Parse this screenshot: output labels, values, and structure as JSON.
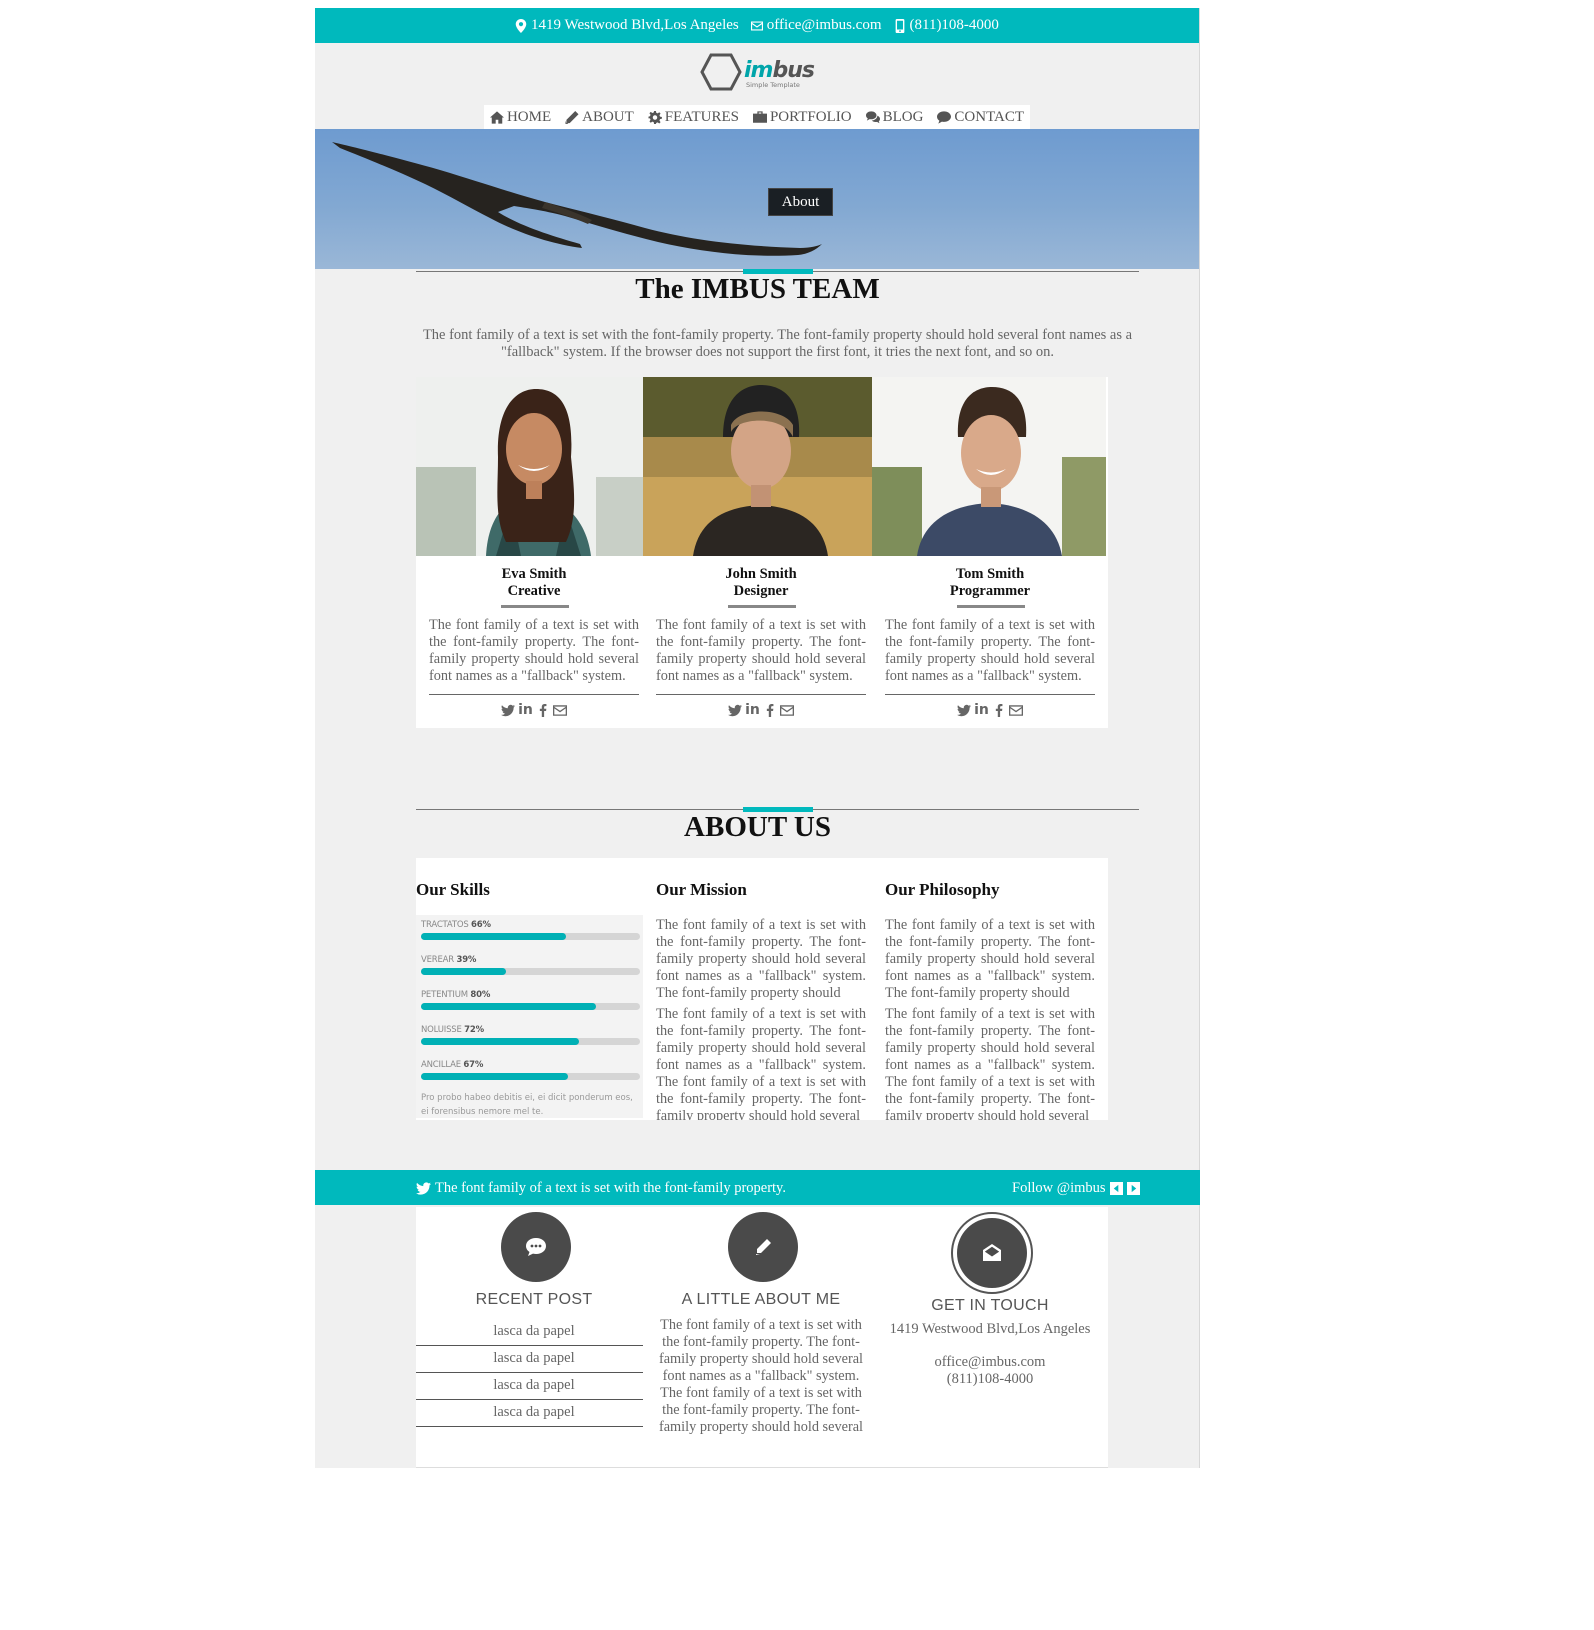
{
  "topbar": {
    "address": "1419 Westwood Blvd,Los Angeles",
    "email": "office@imbus.com",
    "phone": "(811)108-4000"
  },
  "logo": {
    "name_part1": "im",
    "name_part2": "bus",
    "tagline": "Simple Template"
  },
  "nav": [
    {
      "label": "HOME",
      "icon": "home-icon"
    },
    {
      "label": "ABOUT",
      "icon": "pencil-icon"
    },
    {
      "label": "FEATURES",
      "icon": "gear-icon"
    },
    {
      "label": "PORTFOLIO",
      "icon": "briefcase-icon"
    },
    {
      "label": "BLOG",
      "icon": "comments-icon"
    },
    {
      "label": "CONTACT",
      "icon": "comment-icon"
    }
  ],
  "hero": {
    "breadcrumb": "About"
  },
  "team": {
    "title": "The IMBUS TEAM",
    "lead": "The font family of a text is set with the font-family property. The font-family property should hold several font names as a \"fallback\" system. If the browser does not support the first font, it tries the next font, and so on.",
    "members": [
      {
        "name": "Eva Smith",
        "role": "Creative",
        "text": "The font family of a text is set with the font-family property. The font-family property should hold several font names as a \"fallback\" system.",
        "in_label": "in"
      },
      {
        "name": "John Smith",
        "role": "Designer",
        "text": "The font family of a text is set with the font-family property. The font-family property should hold several font names as a \"fallback\" system.",
        "in_label": "in"
      },
      {
        "name": "Tom Smith",
        "role": "Programmer",
        "text": "The font family of a text is set with the font-family property. The font-family property should hold several font names as a \"fallback\" system.",
        "in_label": "in"
      }
    ]
  },
  "about": {
    "title": "ABOUT US",
    "skills": {
      "heading": "Our Skills",
      "items": [
        {
          "label": "TRACTATOS",
          "value": "66%",
          "percent": 66
        },
        {
          "label": "VEREAR",
          "value": "39%",
          "percent": 39
        },
        {
          "label": "PETENTIUM",
          "value": "80%",
          "percent": 80
        },
        {
          "label": "NOLUISSE",
          "value": "72%",
          "percent": 72
        },
        {
          "label": "ANCILLAE",
          "value": "67%",
          "percent": 67
        }
      ],
      "note": "Pro probo habeo debitis ei, ei dicit ponderum eos, ei forensibus nemore mel te."
    },
    "mission": {
      "heading": "Our Mission",
      "p1": "The font family of a text is set with the font-family property. The font-family property should hold several font names as a \"fallback\" system. The font-family property should",
      "p2": "The font family of a text is set with the font-family property. The font-family property should hold several font names as a \"fallback\" system. The font family of a text is set with the font-family property. The font-family property should hold several"
    },
    "philosophy": {
      "heading": "Our Philosophy",
      "p1": "The font family of a text is set with the font-family property. The font-family property should hold several font names as a \"fallback\" system. The font-family property should",
      "p2": "The font family of a text is set with the font-family property. The font-family property should hold several font names as a \"fallback\" system. The font family of a text is set with the font-family property. The font-family property should hold several"
    }
  },
  "twitter": {
    "text": "The font family of a text is set with the font-family property.",
    "follow": "Follow @imbus"
  },
  "footer": {
    "recent": {
      "title": "RECENT POST",
      "posts": [
        "lasca da papel",
        "lasca da papel",
        "lasca da papel",
        "lasca da papel"
      ]
    },
    "aboutme": {
      "title": "A LITTLE ABOUT ME",
      "text": "The font family of a text is set with the font-family property. The font-family property should hold several font names as a \"fallback\" system. The font family of a text is set with the font-family property. The font-family property should hold several"
    },
    "contact": {
      "title": "GET IN TOUCH",
      "address": "1419 Westwood Blvd,Los Angeles",
      "email": "office@imbus.com",
      "phone": "(811)108-4000"
    }
  },
  "colors": {
    "accent": "#00b9bd",
    "page_bg": "#f0f0f0",
    "dark": "#4a4a4a"
  }
}
